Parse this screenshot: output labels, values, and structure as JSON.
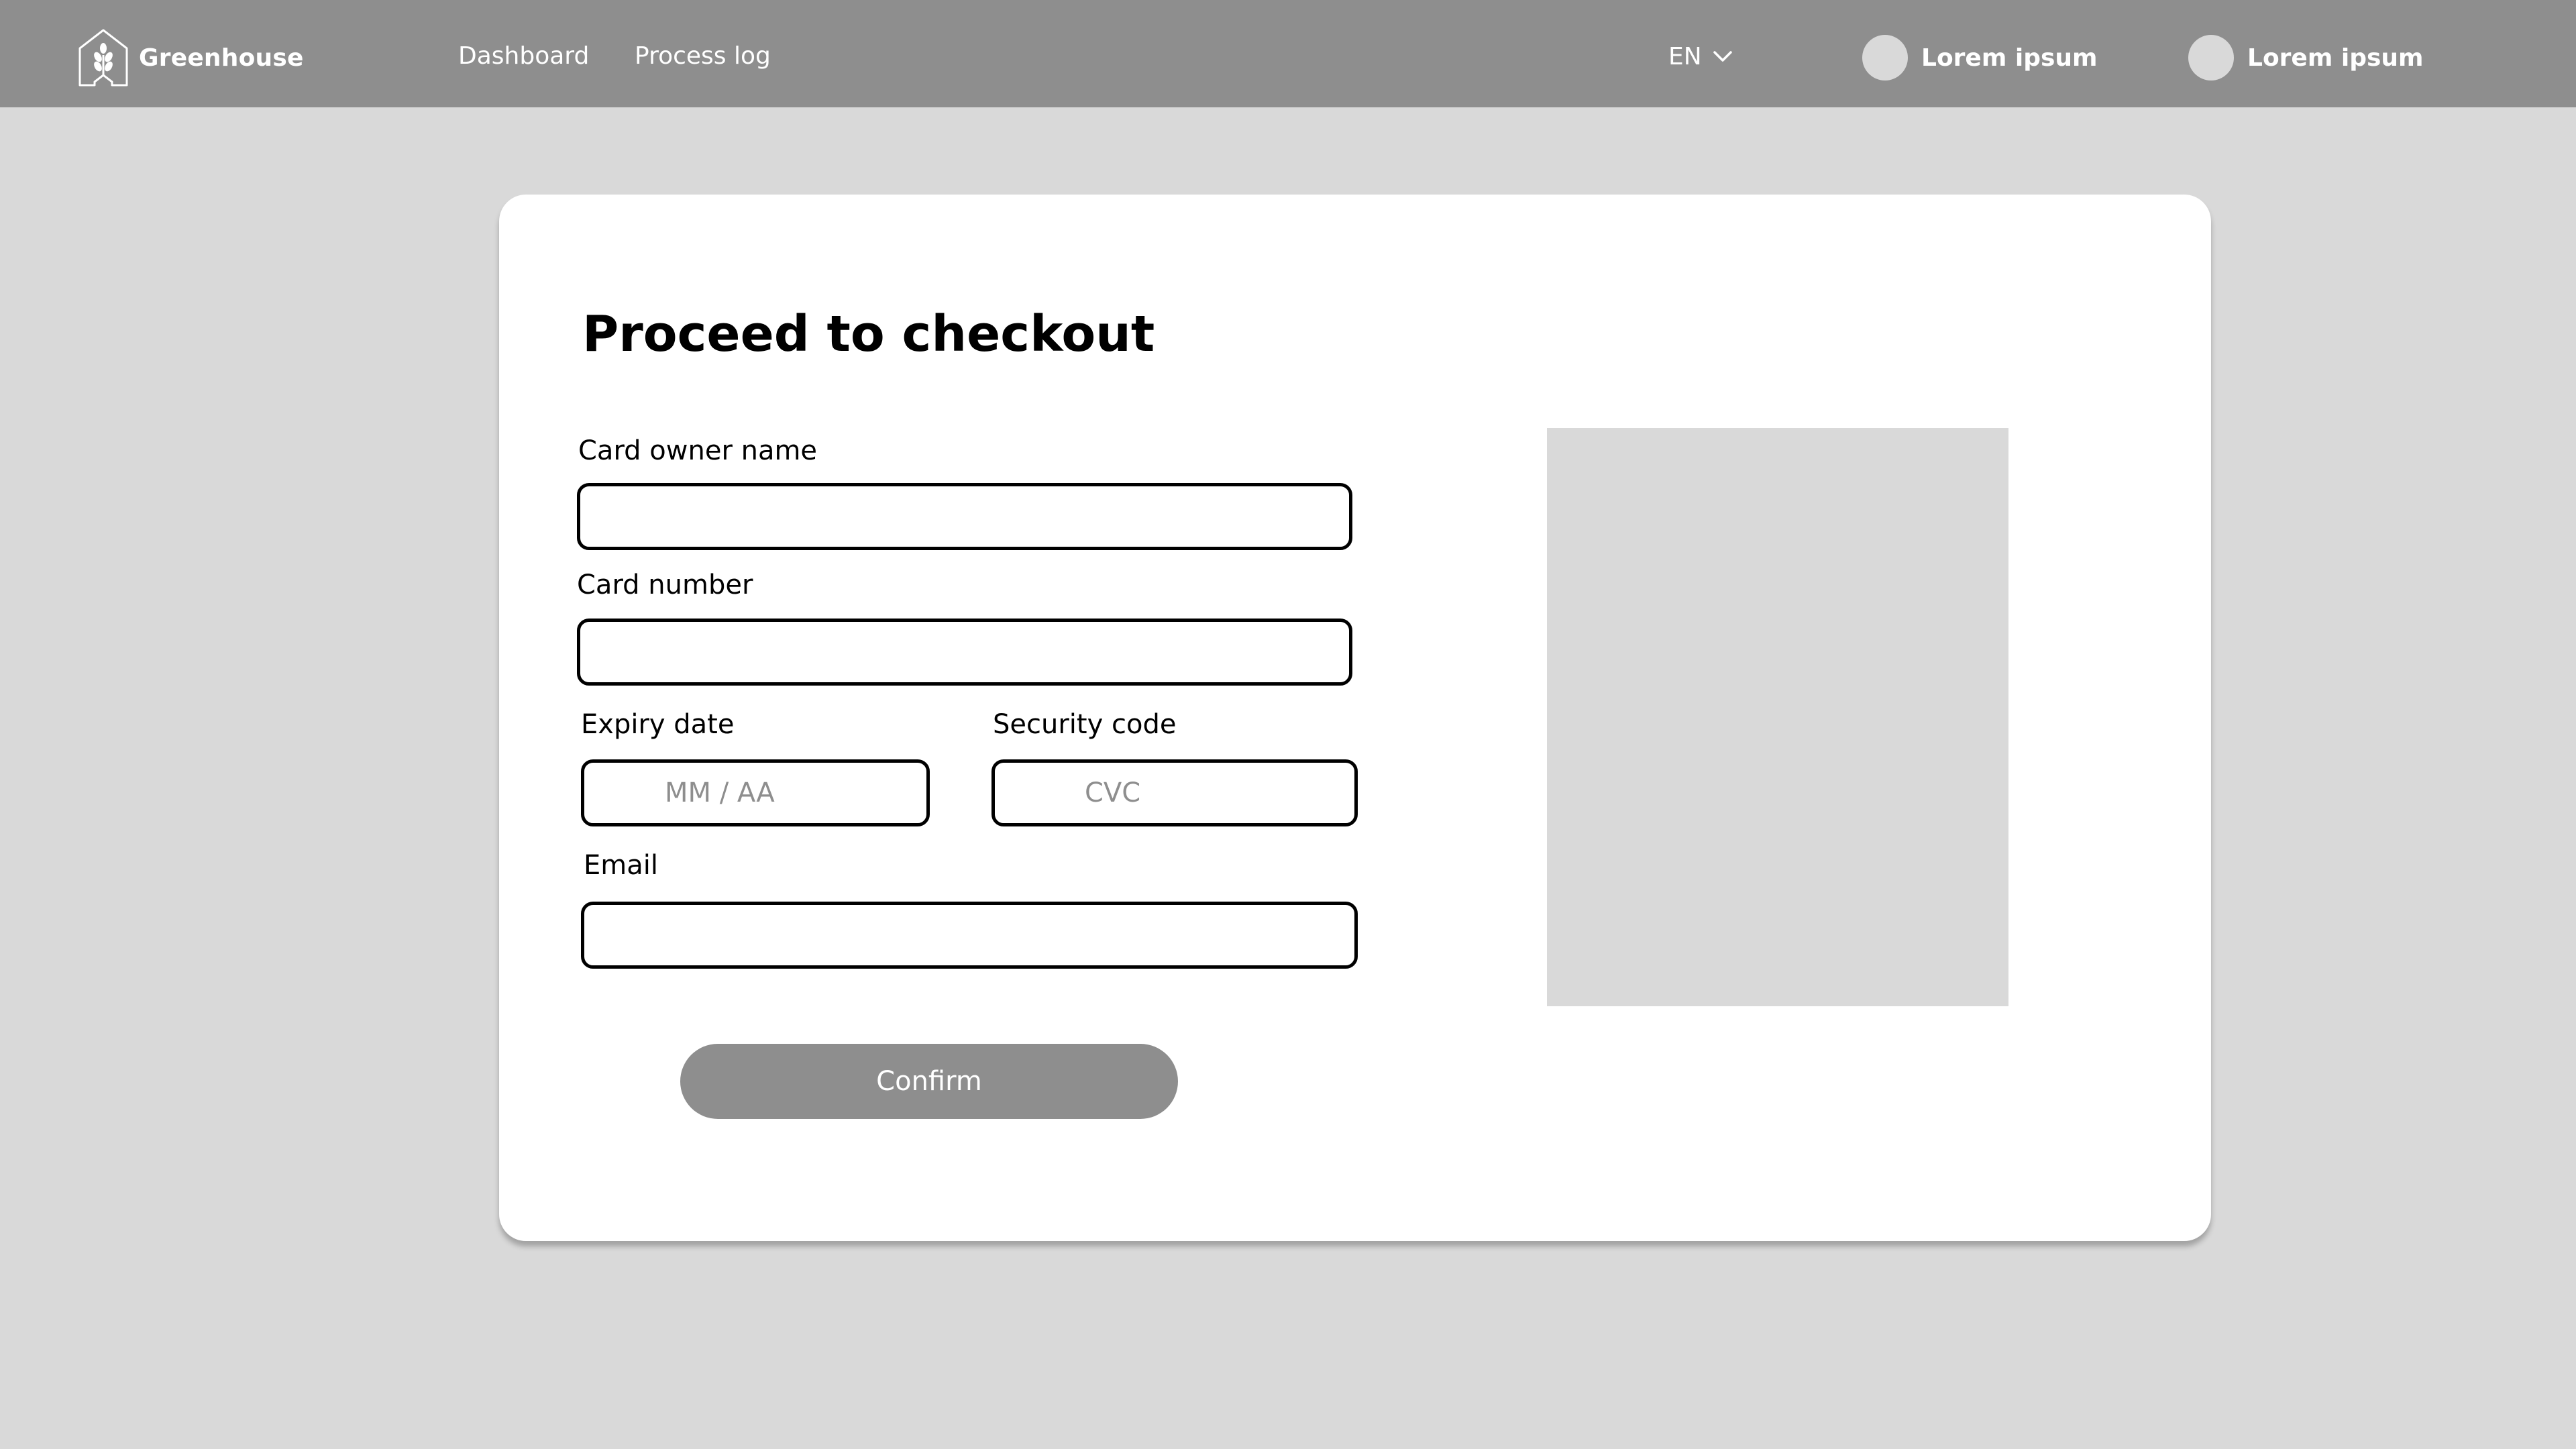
{
  "header": {
    "brand": "Greenhouse",
    "brand_icon": "greenhouse-logo-icon",
    "nav": [
      {
        "label": "Dashboard"
      },
      {
        "label": "Process log"
      }
    ],
    "language": {
      "value": "EN",
      "icon": "chevron-down-icon"
    },
    "users": [
      {
        "name": "Lorem ipsum"
      },
      {
        "name": "Lorem ipsum"
      }
    ]
  },
  "checkout": {
    "title": "Proceed to checkout",
    "fields": {
      "owner_name": {
        "label": "Card owner name",
        "value": "",
        "placeholder": ""
      },
      "card_number": {
        "label": "Card number",
        "value": "",
        "placeholder": ""
      },
      "expiry": {
        "label": "Expiry date",
        "value": "",
        "placeholder": "MM / AA"
      },
      "security": {
        "label": "Security code",
        "value": "",
        "placeholder": "CVC"
      },
      "email": {
        "label": "Email",
        "value": "",
        "placeholder": ""
      }
    },
    "confirm_label": "Confirm"
  },
  "colors": {
    "header_bg": "#8e8e8e",
    "page_bg": "#d9d9d9",
    "card_bg": "#ffffff",
    "button_bg": "#8e8e8e",
    "placeholder_block": "#d9d9d9"
  }
}
